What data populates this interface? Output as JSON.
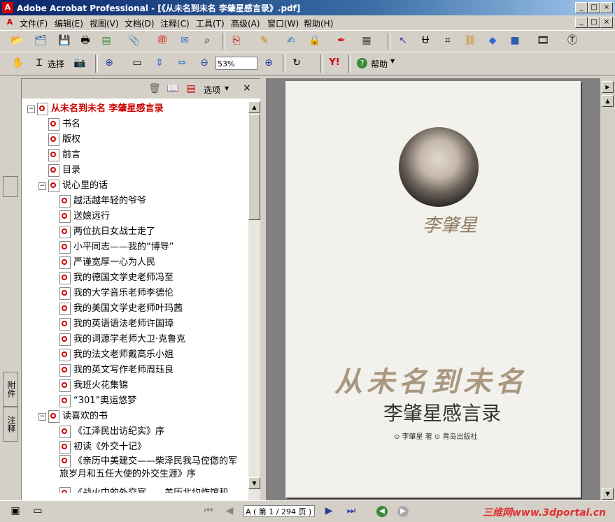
{
  "window": {
    "title": "Adobe Acrobat Professional - [《从未名到未名  李肇星感言录》.pdf]",
    "minimize_glyph": "_",
    "restore_glyph": "□",
    "close_glyph": "×"
  },
  "menubar": {
    "items": [
      "文件(F)",
      "编辑(E)",
      "视图(V)",
      "文档(D)",
      "注释(C)",
      "工具(T)",
      "高级(A)",
      "窗口(W)",
      "帮助(H)"
    ]
  },
  "toolbar2": {
    "select_label": "选择",
    "zoom_value": "53%",
    "help_label": "帮助"
  },
  "nav": {
    "options_label": "选项",
    "items": [
      {
        "label": "从未名到未名 李肇星感言录",
        "level": 0,
        "expander": "−",
        "root": true
      },
      {
        "label": "书名",
        "level": 1
      },
      {
        "label": "版权",
        "level": 1
      },
      {
        "label": "前言",
        "level": 1
      },
      {
        "label": "目录",
        "level": 1
      },
      {
        "label": "说心里的话",
        "level": 1,
        "expander": "−"
      },
      {
        "label": "越活越年轻的爷爷",
        "level": 2
      },
      {
        "label": "送娘远行",
        "level": 2
      },
      {
        "label": "两位抗日女战士走了",
        "level": 2
      },
      {
        "label": "小平同志——我的“博导”",
        "level": 2
      },
      {
        "label": "严谨宽厚一心为人民",
        "level": 2
      },
      {
        "label": "我的德国文学史老师冯至",
        "level": 2
      },
      {
        "label": "我的大学音乐老师李德伦",
        "level": 2
      },
      {
        "label": "我的美国文学史老师叶玛茜",
        "level": 2
      },
      {
        "label": "我的英语语法老师许国璋",
        "level": 2
      },
      {
        "label": "我的词源学老师大卫·克鲁克",
        "level": 2
      },
      {
        "label": "我的法文老师戴高乐小姐",
        "level": 2
      },
      {
        "label": "我的英文写作老师周珏良",
        "level": 2
      },
      {
        "label": "我班火花集锦",
        "level": 2
      },
      {
        "label": "“301”奥运悠梦",
        "level": 2
      },
      {
        "label": "读喜欢的书",
        "level": 1,
        "expander": "−"
      },
      {
        "label": "《江泽民出访纪实》序",
        "level": 2
      },
      {
        "label": "初读《外交十记》",
        "level": 2
      },
      {
        "label": "《亲历中美建交——柴泽民我马倥偬的军旅岁月和五任大使的外交生涯》序",
        "level": 2,
        "wrap": true
      },
      {
        "label": "《战火中的外交官——羌历北约炸馆和",
        "level": 2
      }
    ]
  },
  "left_tabs": {
    "attachments": "附件",
    "comments": "注释"
  },
  "document": {
    "signature": "李肇星",
    "main_title": "从未名到未名",
    "sub_title": "李肇星感言录",
    "author_line": "⊙ 李肇星  著   ⊙ 青岛出版社"
  },
  "statusbar": {
    "page_display": "A ( 第 1 / 294 页 )",
    "watermark": "三维网www.3dportal.cn"
  }
}
